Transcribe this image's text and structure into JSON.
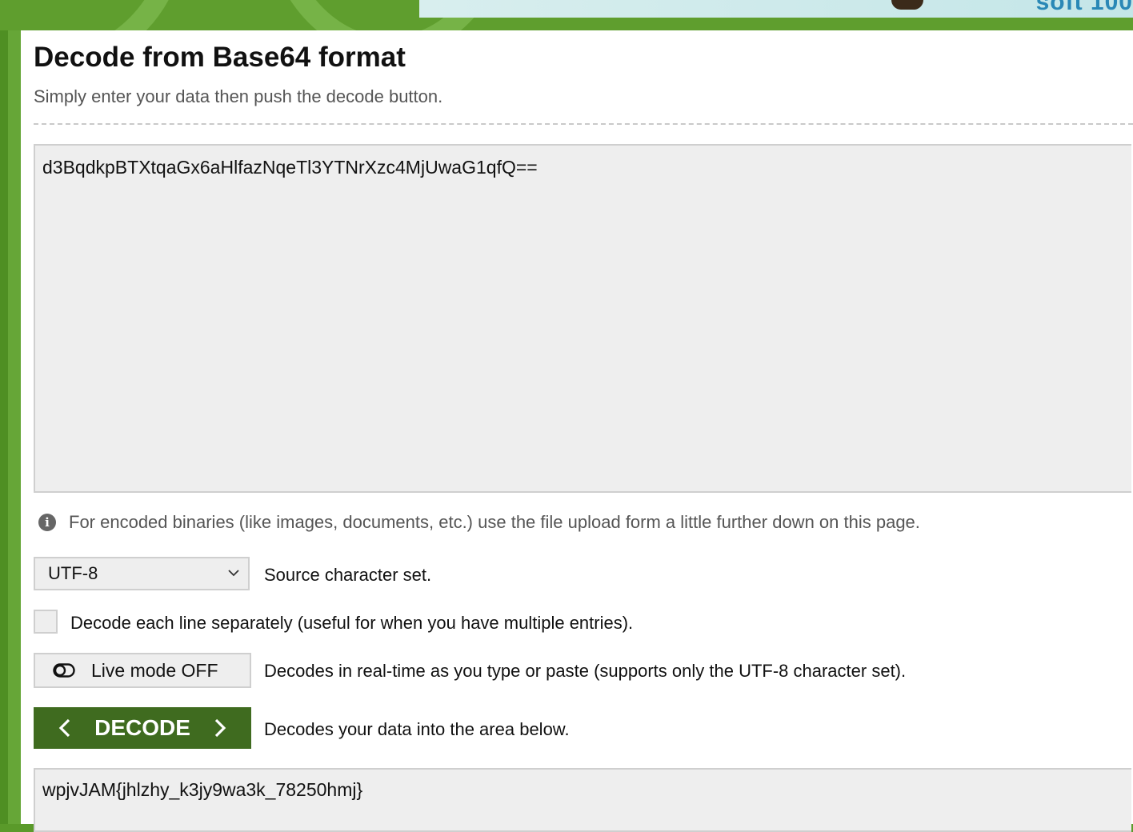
{
  "banner": {
    "text": "soft 100"
  },
  "header": {
    "title": "Decode from Base64 format",
    "subtitle": "Simply enter your data then push the decode button."
  },
  "input": {
    "value": "d3BqdkpBTXtqaGx6aHlfazNqeTl3YTNrXzc4MjUwaG1qfQ=="
  },
  "info": {
    "icon": "info-icon",
    "text": "For encoded binaries (like images, documents, etc.) use the file upload form a little further down on this page."
  },
  "charset": {
    "selected": "UTF-8",
    "label": "Source character set."
  },
  "separate_lines": {
    "checked": false,
    "label": "Decode each line separately (useful for when you have multiple entries)."
  },
  "live_mode": {
    "label": "Live mode OFF",
    "description": "Decodes in real-time as you type or paste (supports only the UTF-8 character set)."
  },
  "decode": {
    "label": "DECODE",
    "description": "Decodes your data into the area below.",
    "color": "#3f6b1f"
  },
  "output": {
    "value": "wpjvJAM{jhlzhy_k3jy9wa3k_78250hmj}"
  }
}
